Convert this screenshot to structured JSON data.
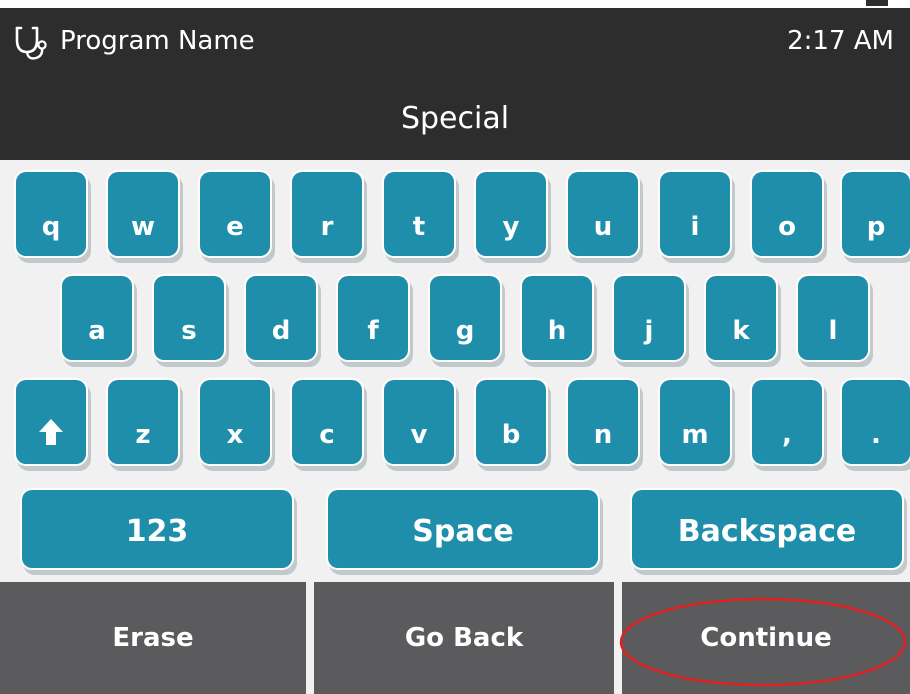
{
  "header": {
    "app_icon": "stethoscope-icon",
    "program_name": "Program Name",
    "time": "2:17 AM",
    "title": "Special"
  },
  "keyboard": {
    "row1": [
      "q",
      "w",
      "e",
      "r",
      "t",
      "y",
      "u",
      "i",
      "o",
      "p"
    ],
    "row2": [
      "a",
      "s",
      "d",
      "f",
      "g",
      "h",
      "j",
      "k",
      "l"
    ],
    "row3": [
      "shift-arrow-icon",
      "z",
      "x",
      "c",
      "v",
      "b",
      "n",
      "m",
      ",",
      "."
    ],
    "row4": [
      "123",
      "Space",
      "Backspace"
    ]
  },
  "footer": {
    "erase": "Erase",
    "go_back": "Go Back",
    "continue": "Continue"
  },
  "colors": {
    "header_bg": "#2d2d2d",
    "key_bg": "#1f8eaa",
    "footer_button_bg": "#5b5b5d",
    "highlight_ellipse": "#e02020"
  }
}
